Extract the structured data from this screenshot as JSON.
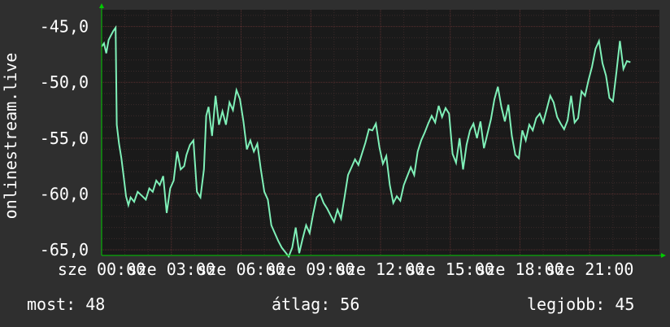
{
  "chart_data": {
    "type": "line",
    "ylabel": "onlinestream.live",
    "ylim": [
      -65.5,
      -43.5
    ],
    "yticks": [
      "-45,0",
      "-50,0",
      "-55,0",
      "-60,0",
      "-65,0"
    ],
    "ytick_values": [
      -45,
      -50,
      -55,
      -60,
      -65
    ],
    "xlim": [
      0,
      24
    ],
    "xticks": [
      {
        "label": "sze 00:00",
        "hour": 0
      },
      {
        "label": "sze 03:00",
        "hour": 3
      },
      {
        "label": "sze 06:00",
        "hour": 6
      },
      {
        "label": "sze 09:00",
        "hour": 9
      },
      {
        "label": "sze 12:00",
        "hour": 12
      },
      {
        "label": "sze 15:00",
        "hour": 15
      },
      {
        "label": "sze 18:00",
        "hour": 18
      },
      {
        "label": "sze 21:00",
        "hour": 21
      }
    ],
    "grid": true,
    "colors": {
      "background": "#2f2f2f",
      "plot_bg": "#1a1a1a",
      "line": "#7ff0b8",
      "grid": "#5a2f2f",
      "axis": "#00cc00"
    },
    "series": [
      {
        "values": [
          [
            0.0,
            -46.8
          ],
          [
            0.1,
            -46.5
          ],
          [
            0.2,
            -47.4
          ],
          [
            0.3,
            -46.2
          ],
          [
            0.4,
            -45.8
          ],
          [
            0.5,
            -45.4
          ],
          [
            0.6,
            -45.1
          ],
          [
            0.65,
            -53.8
          ],
          [
            0.75,
            -55.5
          ],
          [
            0.85,
            -56.8
          ],
          [
            0.95,
            -58.5
          ],
          [
            1.05,
            -60.2
          ],
          [
            1.15,
            -61.0
          ],
          [
            1.25,
            -60.3
          ],
          [
            1.4,
            -60.7
          ],
          [
            1.55,
            -59.8
          ],
          [
            1.75,
            -60.2
          ],
          [
            1.9,
            -60.5
          ],
          [
            2.05,
            -59.5
          ],
          [
            2.2,
            -59.8
          ],
          [
            2.35,
            -58.8
          ],
          [
            2.5,
            -59.2
          ],
          [
            2.65,
            -58.4
          ],
          [
            2.8,
            -61.7
          ],
          [
            2.95,
            -59.5
          ],
          [
            3.1,
            -58.8
          ],
          [
            3.25,
            -56.2
          ],
          [
            3.4,
            -57.8
          ],
          [
            3.55,
            -57.5
          ],
          [
            3.65,
            -56.5
          ],
          [
            3.8,
            -55.6
          ],
          [
            3.95,
            -55.2
          ],
          [
            4.1,
            -59.8
          ],
          [
            4.25,
            -60.3
          ],
          [
            4.4,
            -57.8
          ],
          [
            4.5,
            -53.0
          ],
          [
            4.6,
            -52.2
          ],
          [
            4.75,
            -54.8
          ],
          [
            4.9,
            -51.2
          ],
          [
            5.05,
            -53.8
          ],
          [
            5.2,
            -52.6
          ],
          [
            5.35,
            -53.8
          ],
          [
            5.5,
            -51.8
          ],
          [
            5.65,
            -52.5
          ],
          [
            5.8,
            -50.7
          ],
          [
            5.95,
            -51.5
          ],
          [
            6.1,
            -53.5
          ],
          [
            6.25,
            -56.0
          ],
          [
            6.4,
            -55.2
          ],
          [
            6.55,
            -56.2
          ],
          [
            6.7,
            -55.5
          ],
          [
            6.85,
            -57.8
          ],
          [
            7.0,
            -59.8
          ],
          [
            7.15,
            -60.5
          ],
          [
            7.3,
            -62.8
          ],
          [
            7.45,
            -63.5
          ],
          [
            7.6,
            -64.2
          ],
          [
            7.75,
            -64.8
          ],
          [
            7.9,
            -65.2
          ],
          [
            8.05,
            -65.6
          ],
          [
            8.2,
            -64.8
          ],
          [
            8.35,
            -63.0
          ],
          [
            8.5,
            -65.3
          ],
          [
            8.65,
            -64.0
          ],
          [
            8.8,
            -62.8
          ],
          [
            8.95,
            -63.5
          ],
          [
            9.1,
            -61.8
          ],
          [
            9.25,
            -60.3
          ],
          [
            9.4,
            -60.0
          ],
          [
            9.55,
            -60.8
          ],
          [
            9.7,
            -61.3
          ],
          [
            9.85,
            -61.9
          ],
          [
            10.0,
            -62.5
          ],
          [
            10.15,
            -61.4
          ],
          [
            10.3,
            -62.2
          ],
          [
            10.45,
            -60.3
          ],
          [
            10.6,
            -58.3
          ],
          [
            10.75,
            -57.6
          ],
          [
            10.9,
            -56.9
          ],
          [
            11.05,
            -57.4
          ],
          [
            11.2,
            -56.4
          ],
          [
            11.35,
            -55.4
          ],
          [
            11.5,
            -54.2
          ],
          [
            11.65,
            -54.3
          ],
          [
            11.8,
            -53.7
          ],
          [
            11.95,
            -55.8
          ],
          [
            12.1,
            -57.3
          ],
          [
            12.25,
            -56.6
          ],
          [
            12.4,
            -59.2
          ],
          [
            12.55,
            -60.8
          ],
          [
            12.7,
            -60.2
          ],
          [
            12.85,
            -60.6
          ],
          [
            13.0,
            -59.2
          ],
          [
            13.15,
            -58.4
          ],
          [
            13.3,
            -57.6
          ],
          [
            13.45,
            -58.3
          ],
          [
            13.6,
            -56.2
          ],
          [
            13.75,
            -55.2
          ],
          [
            13.9,
            -54.5
          ],
          [
            14.05,
            -53.7
          ],
          [
            14.2,
            -53.0
          ],
          [
            14.35,
            -53.6
          ],
          [
            14.5,
            -52.1
          ],
          [
            14.65,
            -53.1
          ],
          [
            14.8,
            -52.3
          ],
          [
            14.95,
            -52.8
          ],
          [
            15.1,
            -56.4
          ],
          [
            15.25,
            -57.2
          ],
          [
            15.4,
            -55.0
          ],
          [
            15.55,
            -57.8
          ],
          [
            15.7,
            -55.6
          ],
          [
            15.85,
            -54.3
          ],
          [
            16.0,
            -53.7
          ],
          [
            16.15,
            -55.0
          ],
          [
            16.3,
            -53.5
          ],
          [
            16.45,
            -55.9
          ],
          [
            16.6,
            -54.6
          ],
          [
            16.75,
            -53.3
          ],
          [
            16.9,
            -51.5
          ],
          [
            17.05,
            -50.4
          ],
          [
            17.2,
            -52.2
          ],
          [
            17.35,
            -53.5
          ],
          [
            17.5,
            -52.0
          ],
          [
            17.65,
            -54.8
          ],
          [
            17.8,
            -56.5
          ],
          [
            17.95,
            -56.8
          ],
          [
            18.1,
            -54.3
          ],
          [
            18.25,
            -55.2
          ],
          [
            18.4,
            -53.8
          ],
          [
            18.55,
            -54.3
          ],
          [
            18.7,
            -53.2
          ],
          [
            18.85,
            -52.8
          ],
          [
            19.0,
            -53.6
          ],
          [
            19.15,
            -52.4
          ],
          [
            19.3,
            -51.2
          ],
          [
            19.45,
            -51.8
          ],
          [
            19.6,
            -53.1
          ],
          [
            19.75,
            -53.7
          ],
          [
            19.9,
            -54.2
          ],
          [
            20.05,
            -53.4
          ],
          [
            20.2,
            -51.2
          ],
          [
            20.35,
            -53.6
          ],
          [
            20.5,
            -53.2
          ],
          [
            20.65,
            -50.8
          ],
          [
            20.8,
            -51.2
          ],
          [
            20.95,
            -49.8
          ],
          [
            21.1,
            -48.6
          ],
          [
            21.25,
            -47.0
          ],
          [
            21.4,
            -46.3
          ],
          [
            21.55,
            -48.3
          ],
          [
            21.7,
            -49.4
          ],
          [
            21.85,
            -51.4
          ],
          [
            22.0,
            -51.7
          ],
          [
            22.15,
            -49.1
          ],
          [
            22.3,
            -46.3
          ],
          [
            22.45,
            -48.8
          ],
          [
            22.6,
            -48.1
          ],
          [
            22.75,
            -48.2
          ]
        ]
      }
    ]
  },
  "stats": {
    "current": "most: 48",
    "average": "átlag: 56",
    "best": "legjobb: 45"
  }
}
